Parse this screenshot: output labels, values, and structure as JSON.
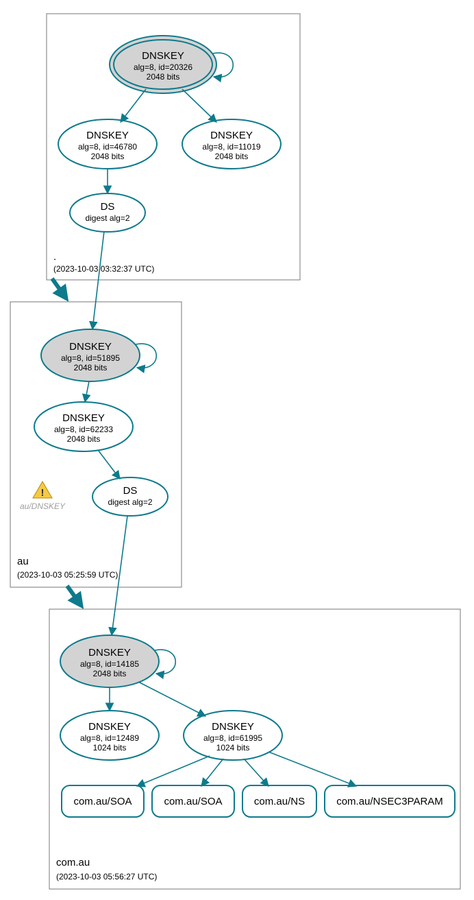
{
  "zones": {
    "root": {
      "label": ".",
      "time": "(2023-10-03 03:32:37 UTC)"
    },
    "au": {
      "label": "au",
      "time": "(2023-10-03 05:25:59 UTC)"
    },
    "comau": {
      "label": "com.au",
      "time": "(2023-10-03 05:56:27 UTC)"
    }
  },
  "nodes": {
    "root_ksk": {
      "title": "DNSKEY",
      "l1": "alg=8, id=20326",
      "l2": "2048 bits"
    },
    "root_zsk1": {
      "title": "DNSKEY",
      "l1": "alg=8, id=46780",
      "l2": "2048 bits"
    },
    "root_zsk2": {
      "title": "DNSKEY",
      "l1": "alg=8, id=11019",
      "l2": "2048 bits"
    },
    "root_ds": {
      "title": "DS",
      "l1": "digest alg=2"
    },
    "au_ksk": {
      "title": "DNSKEY",
      "l1": "alg=8, id=51895",
      "l2": "2048 bits"
    },
    "au_zsk": {
      "title": "DNSKEY",
      "l1": "alg=8, id=62233",
      "l2": "2048 bits"
    },
    "au_ds": {
      "title": "DS",
      "l1": "digest alg=2"
    },
    "au_warn": {
      "label": "au/DNSKEY"
    },
    "comau_ksk": {
      "title": "DNSKEY",
      "l1": "alg=8, id=14185",
      "l2": "2048 bits"
    },
    "comau_zsk1": {
      "title": "DNSKEY",
      "l1": "alg=8, id=12489",
      "l2": "1024 bits"
    },
    "comau_zsk2": {
      "title": "DNSKEY",
      "l1": "alg=8, id=61995",
      "l2": "1024 bits"
    },
    "rr1": {
      "label": "com.au/SOA"
    },
    "rr2": {
      "label": "com.au/SOA"
    },
    "rr3": {
      "label": "com.au/NS"
    },
    "rr4": {
      "label": "com.au/NSEC3PARAM"
    }
  },
  "chart_data": {
    "type": "diagram",
    "title": "DNSSEC delegation chain for com.au",
    "zones": [
      {
        "name": ".",
        "timestamp": "2023-10-03 03:32:37 UTC",
        "keys": [
          {
            "role": "KSK",
            "alg": 8,
            "id": 20326,
            "bits": 2048,
            "self_signed": true
          },
          {
            "role": "ZSK",
            "alg": 8,
            "id": 46780,
            "bits": 2048
          },
          {
            "role": "ZSK",
            "alg": 8,
            "id": 11019,
            "bits": 2048
          }
        ],
        "ds": [
          {
            "digest_alg": 2,
            "child": "au"
          }
        ]
      },
      {
        "name": "au",
        "timestamp": "2023-10-03 05:25:59 UTC",
        "keys": [
          {
            "role": "KSK",
            "alg": 8,
            "id": 51895,
            "bits": 2048,
            "self_signed": true
          },
          {
            "role": "ZSK",
            "alg": 8,
            "id": 62233,
            "bits": 2048
          }
        ],
        "ds": [
          {
            "digest_alg": 2,
            "child": "com.au"
          }
        ],
        "warnings": [
          "au/DNSKEY"
        ]
      },
      {
        "name": "com.au",
        "timestamp": "2023-10-03 05:56:27 UTC",
        "keys": [
          {
            "role": "KSK",
            "alg": 8,
            "id": 14185,
            "bits": 2048,
            "self_signed": true
          },
          {
            "role": "ZSK",
            "alg": 8,
            "id": 12489,
            "bits": 1024
          },
          {
            "role": "ZSK",
            "alg": 8,
            "id": 61995,
            "bits": 1024
          }
        ],
        "rrsets": [
          "com.au/SOA",
          "com.au/SOA",
          "com.au/NS",
          "com.au/NSEC3PARAM"
        ]
      }
    ],
    "edges": [
      {
        "from": "./DNSKEY/20326",
        "to": "./DNSKEY/20326"
      },
      {
        "from": "./DNSKEY/20326",
        "to": "./DNSKEY/46780"
      },
      {
        "from": "./DNSKEY/20326",
        "to": "./DNSKEY/11019"
      },
      {
        "from": "./DNSKEY/46780",
        "to": "./DS(au)"
      },
      {
        "from": "./DS(au)",
        "to": "au/DNSKEY/51895"
      },
      {
        "from": "au/DNSKEY/51895",
        "to": "au/DNSKEY/51895"
      },
      {
        "from": "au/DNSKEY/51895",
        "to": "au/DNSKEY/62233"
      },
      {
        "from": "au/DNSKEY/62233",
        "to": "au/DS(com.au)"
      },
      {
        "from": "au/DS(com.au)",
        "to": "com.au/DNSKEY/14185"
      },
      {
        "from": "com.au/DNSKEY/14185",
        "to": "com.au/DNSKEY/14185"
      },
      {
        "from": "com.au/DNSKEY/14185",
        "to": "com.au/DNSKEY/12489"
      },
      {
        "from": "com.au/DNSKEY/14185",
        "to": "com.au/DNSKEY/61995"
      },
      {
        "from": "com.au/DNSKEY/61995",
        "to": "com.au/SOA"
      },
      {
        "from": "com.au/DNSKEY/61995",
        "to": "com.au/SOA"
      },
      {
        "from": "com.au/DNSKEY/61995",
        "to": "com.au/NS"
      },
      {
        "from": "com.au/DNSKEY/61995",
        "to": "com.au/NSEC3PARAM"
      }
    ]
  }
}
